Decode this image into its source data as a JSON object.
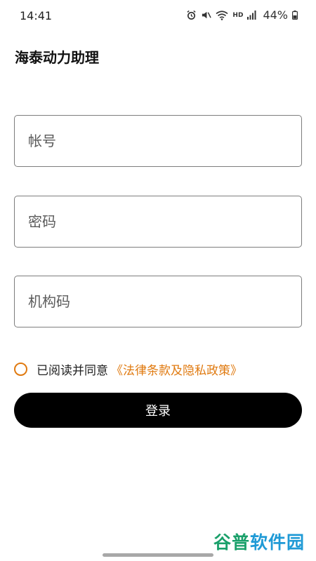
{
  "status_bar": {
    "time": "14:41",
    "battery": "44%",
    "network_label": "HD"
  },
  "app": {
    "title": "海泰动力助理"
  },
  "form": {
    "account_placeholder": "帐号",
    "password_placeholder": "密码",
    "org_code_placeholder": "机构码"
  },
  "agreement": {
    "text": "已阅读并同意",
    "link": "《法律条款及隐私政策》",
    "checked": false,
    "accent_color": "#e07a10"
  },
  "login": {
    "label": "登录"
  },
  "watermark": {
    "part1": "谷普",
    "part2": "软件园"
  }
}
